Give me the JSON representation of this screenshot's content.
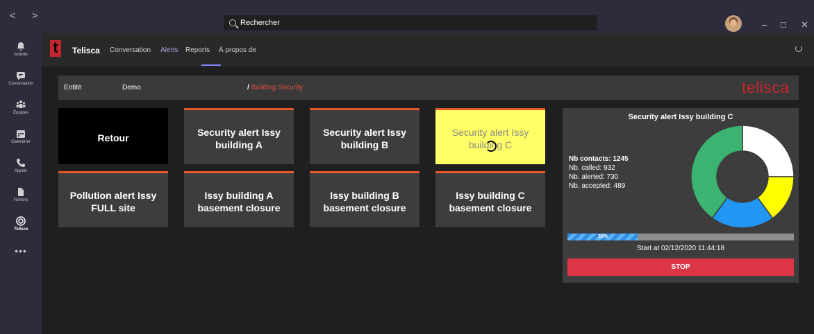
{
  "titlebar": {
    "nav": "< >",
    "search_text": "Rechercher",
    "window_controls": [
      "–",
      "□",
      "✕"
    ]
  },
  "rail": [
    {
      "label": "Activité",
      "icon": "bell-icon"
    },
    {
      "label": "Conversation",
      "icon": "chat-icon"
    },
    {
      "label": "Équipes",
      "icon": "teams-icon"
    },
    {
      "label": "Calendrier",
      "icon": "calendar-icon"
    },
    {
      "label": "Appels",
      "icon": "phone-icon"
    },
    {
      "label": "Fichiers",
      "icon": "file-icon"
    },
    {
      "label": "Telisca",
      "icon": "telisca-icon"
    }
  ],
  "rail_more": "•••",
  "app": {
    "name": "Telisca",
    "logo_letter": "t",
    "tabs": [
      "Conversation",
      "Alerts",
      "Reports",
      "À propos de"
    ],
    "active_tab": "Alerts"
  },
  "crumbs": {
    "entity_label": "Entité",
    "entity_value": "Demo",
    "path_sep": "/",
    "path": "Building Security",
    "brand": "telisca"
  },
  "tiles": [
    {
      "label": "Retour",
      "style": "back"
    },
    {
      "label": "Security alert Issy building A",
      "style": "bar"
    },
    {
      "label": "Security alert Issy building B",
      "style": "bar"
    },
    {
      "label": "Security alert Issy building C",
      "style": "active"
    },
    {
      "label": "Pollution alert Issy FULL site",
      "style": "bar"
    },
    {
      "label": "Issy building A basement closure",
      "style": "bar"
    },
    {
      "label": "Issy building B basement closure",
      "style": "bar"
    },
    {
      "label": "Issy building C basement closure",
      "style": "bar"
    }
  ],
  "panel": {
    "title": "Security alert Issy building C",
    "stats": {
      "contacts": "Nb contacts: 1245",
      "called": "Nb. called: 932",
      "alerted": "Nb. alerted: 730",
      "accepted": "Nb. accepted: 489"
    },
    "donut": [
      {
        "value": 0.25,
        "color": "#ffffff"
      },
      {
        "value": 0.15,
        "color": "#ffff00"
      },
      {
        "value": 0.2,
        "color": "#2196f3"
      },
      {
        "value": 0.4,
        "color": "#3cb371"
      }
    ],
    "progress": 0.31,
    "progress_label": "31%",
    "start_text": "Start at 02/12/2020 11:44:18",
    "stop_label": "STOP"
  }
}
